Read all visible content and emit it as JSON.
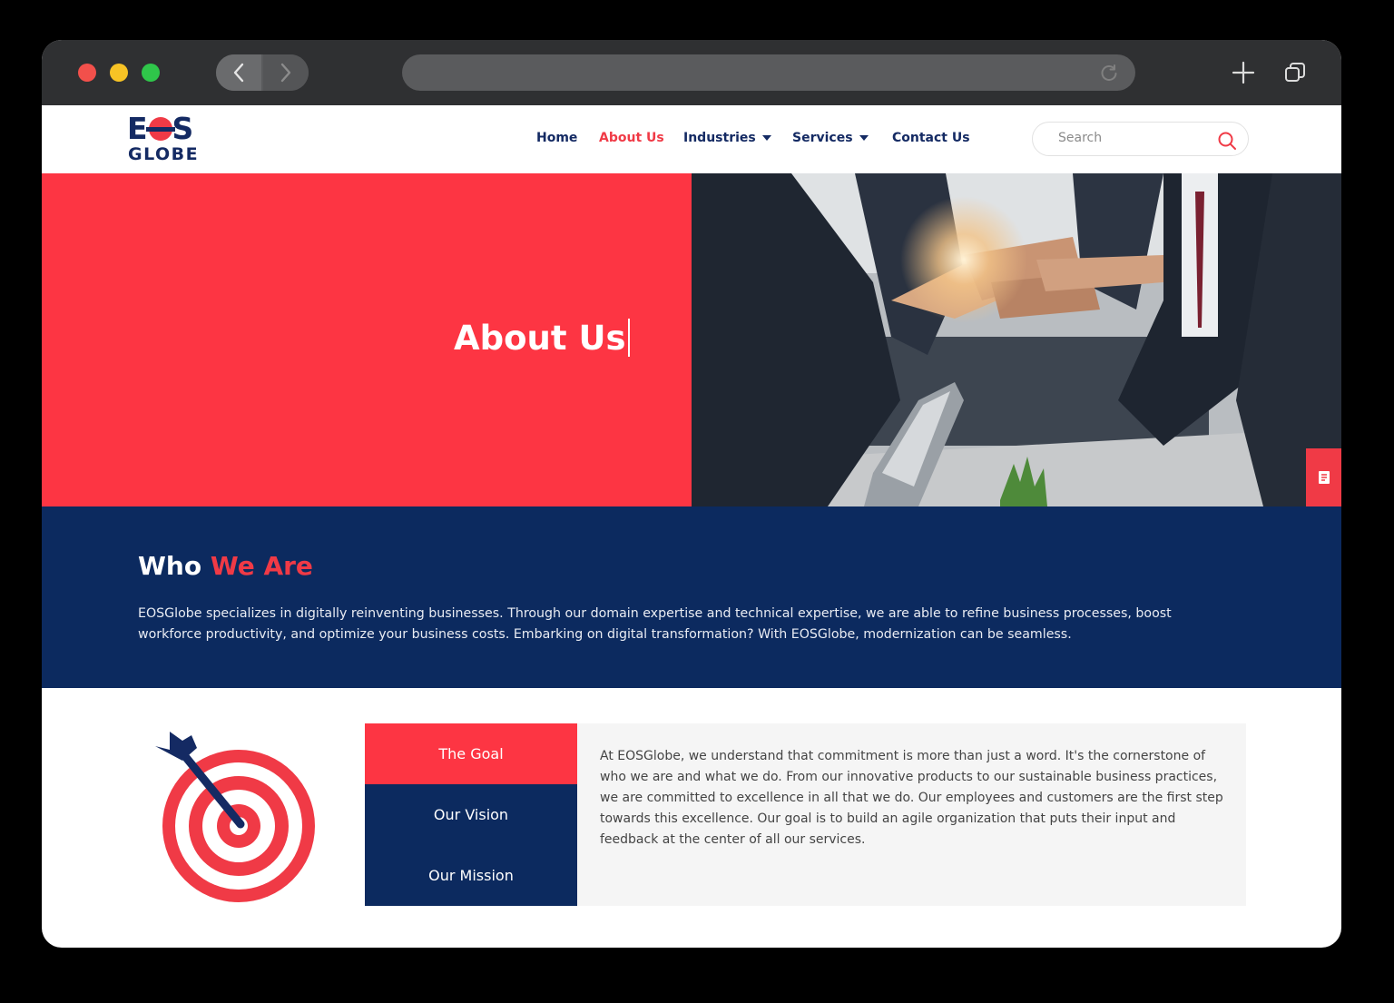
{
  "browser": {
    "back_icon": "chevron-left-icon",
    "forward_icon": "chevron-right-icon",
    "reload_icon": "reload-icon",
    "new_tab_icon": "plus-icon",
    "tabs_icon": "tabs-overview-icon"
  },
  "brand": {
    "line1": "EOS",
    "line2": "GLOBE",
    "primary": "#142a63",
    "accent": "#f03a46"
  },
  "nav": {
    "items": [
      {
        "label": "Home",
        "active": false,
        "dropdown": false
      },
      {
        "label": "About Us",
        "active": true,
        "dropdown": false
      },
      {
        "label": "Industries",
        "active": false,
        "dropdown": true
      },
      {
        "label": "Services",
        "active": false,
        "dropdown": true
      },
      {
        "label": "Contact Us",
        "active": false,
        "dropdown": false
      }
    ],
    "search_placeholder": "Search"
  },
  "hero": {
    "title": "About Us",
    "bg_color": "#fd3543"
  },
  "side_tools": [
    "document-icon",
    "phone-icon",
    "share-icon"
  ],
  "who": {
    "title_part1": "Who",
    "title_part2": "We Are",
    "body": "EOSGlobe specializes in digitally reinventing businesses. Through our domain expertise and technical expertise, we are able to refine business processes, boost workforce productivity, and optimize your business costs. Embarking on digital transformation? With EOSGlobe, modernization can be seamless.",
    "bg_color": "#0c2a5f"
  },
  "tabs": {
    "items": [
      {
        "label": "The Goal",
        "active": true
      },
      {
        "label": "Our Vision",
        "active": false
      },
      {
        "label": "Our Mission",
        "active": false
      }
    ],
    "active_content": "At EOSGlobe, we understand that commitment is more than just a word. It's the cornerstone of who we are and what we do. From our innovative products to our sustainable business practices, we are committed to excellence in all that we do. Our employees and customers are the first step towards this excellence. Our goal is to build an agile organization that puts their input and feedback at the center of all our services."
  }
}
